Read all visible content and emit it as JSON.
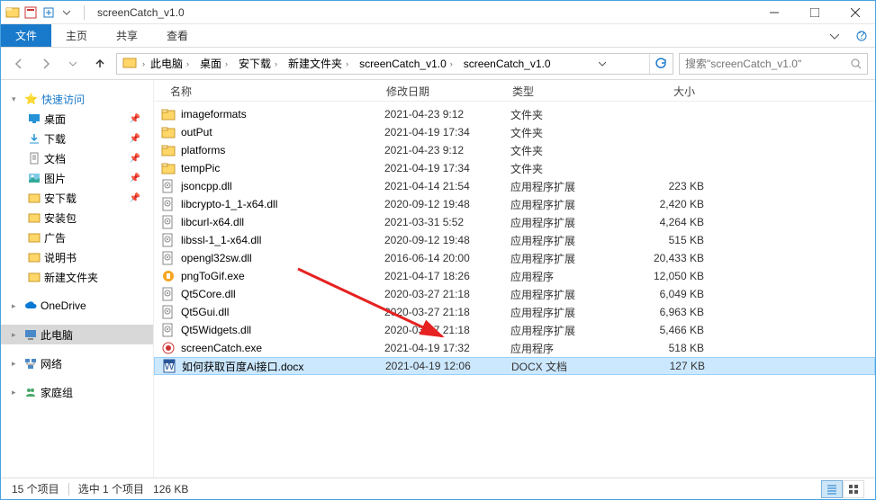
{
  "window": {
    "title": "screenCatch_v1.0"
  },
  "ribbon": {
    "file": "文件",
    "home": "主页",
    "share": "共享",
    "view": "查看"
  },
  "breadcrumb": {
    "items": [
      "此电脑",
      "桌面",
      "安下载",
      "新建文件夹",
      "screenCatch_v1.0",
      "screenCatch_v1.0"
    ]
  },
  "search": {
    "placeholder": "搜索\"screenCatch_v1.0\""
  },
  "headers": {
    "name": "名称",
    "date": "修改日期",
    "type": "类型",
    "size": "大小"
  },
  "sidebar": {
    "quick": "快速访问",
    "desktop": "桌面",
    "downloads": "下载",
    "documents": "文档",
    "pictures": "图片",
    "anxz": "安下载",
    "anzhuangbao": "安装包",
    "guanggao": "广告",
    "shuomingshu": "说明书",
    "newfolder": "新建文件夹",
    "onedrive": "OneDrive",
    "thispc": "此电脑",
    "network": "网络",
    "homegroup": "家庭组"
  },
  "files": [
    {
      "icon": "folder",
      "name": "imageformats",
      "date": "2021-04-23 9:12",
      "type": "文件夹",
      "size": ""
    },
    {
      "icon": "folder",
      "name": "outPut",
      "date": "2021-04-19 17:34",
      "type": "文件夹",
      "size": ""
    },
    {
      "icon": "folder",
      "name": "platforms",
      "date": "2021-04-23 9:12",
      "type": "文件夹",
      "size": ""
    },
    {
      "icon": "folder",
      "name": "tempPic",
      "date": "2021-04-19 17:34",
      "type": "文件夹",
      "size": ""
    },
    {
      "icon": "dll",
      "name": "jsoncpp.dll",
      "date": "2021-04-14 21:54",
      "type": "应用程序扩展",
      "size": "223 KB"
    },
    {
      "icon": "dll",
      "name": "libcrypto-1_1-x64.dll",
      "date": "2020-09-12 19:48",
      "type": "应用程序扩展",
      "size": "2,420 KB"
    },
    {
      "icon": "dll",
      "name": "libcurl-x64.dll",
      "date": "2021-03-31 5:52",
      "type": "应用程序扩展",
      "size": "4,264 KB"
    },
    {
      "icon": "dll",
      "name": "libssl-1_1-x64.dll",
      "date": "2020-09-12 19:48",
      "type": "应用程序扩展",
      "size": "515 KB"
    },
    {
      "icon": "dll",
      "name": "opengl32sw.dll",
      "date": "2016-06-14 20:00",
      "type": "应用程序扩展",
      "size": "20,433 KB"
    },
    {
      "icon": "exe-o",
      "name": "pngToGif.exe",
      "date": "2021-04-17 18:26",
      "type": "应用程序",
      "size": "12,050 KB"
    },
    {
      "icon": "dll",
      "name": "Qt5Core.dll",
      "date": "2020-03-27 21:18",
      "type": "应用程序扩展",
      "size": "6,049 KB"
    },
    {
      "icon": "dll",
      "name": "Qt5Gui.dll",
      "date": "2020-03-27 21:18",
      "type": "应用程序扩展",
      "size": "6,963 KB"
    },
    {
      "icon": "dll",
      "name": "Qt5Widgets.dll",
      "date": "2020-03-27 21:18",
      "type": "应用程序扩展",
      "size": "5,466 KB"
    },
    {
      "icon": "exe-r",
      "name": "screenCatch.exe",
      "date": "2021-04-19 17:32",
      "type": "应用程序",
      "size": "518 KB"
    },
    {
      "icon": "docx",
      "name": "如何获取百度Ai接口.docx",
      "date": "2021-04-19 12:06",
      "type": "DOCX 文档",
      "size": "127 KB",
      "selected": true
    }
  ],
  "status": {
    "count": "15 个项目",
    "selected": "选中 1 个项目",
    "selsize": "126 KB"
  }
}
